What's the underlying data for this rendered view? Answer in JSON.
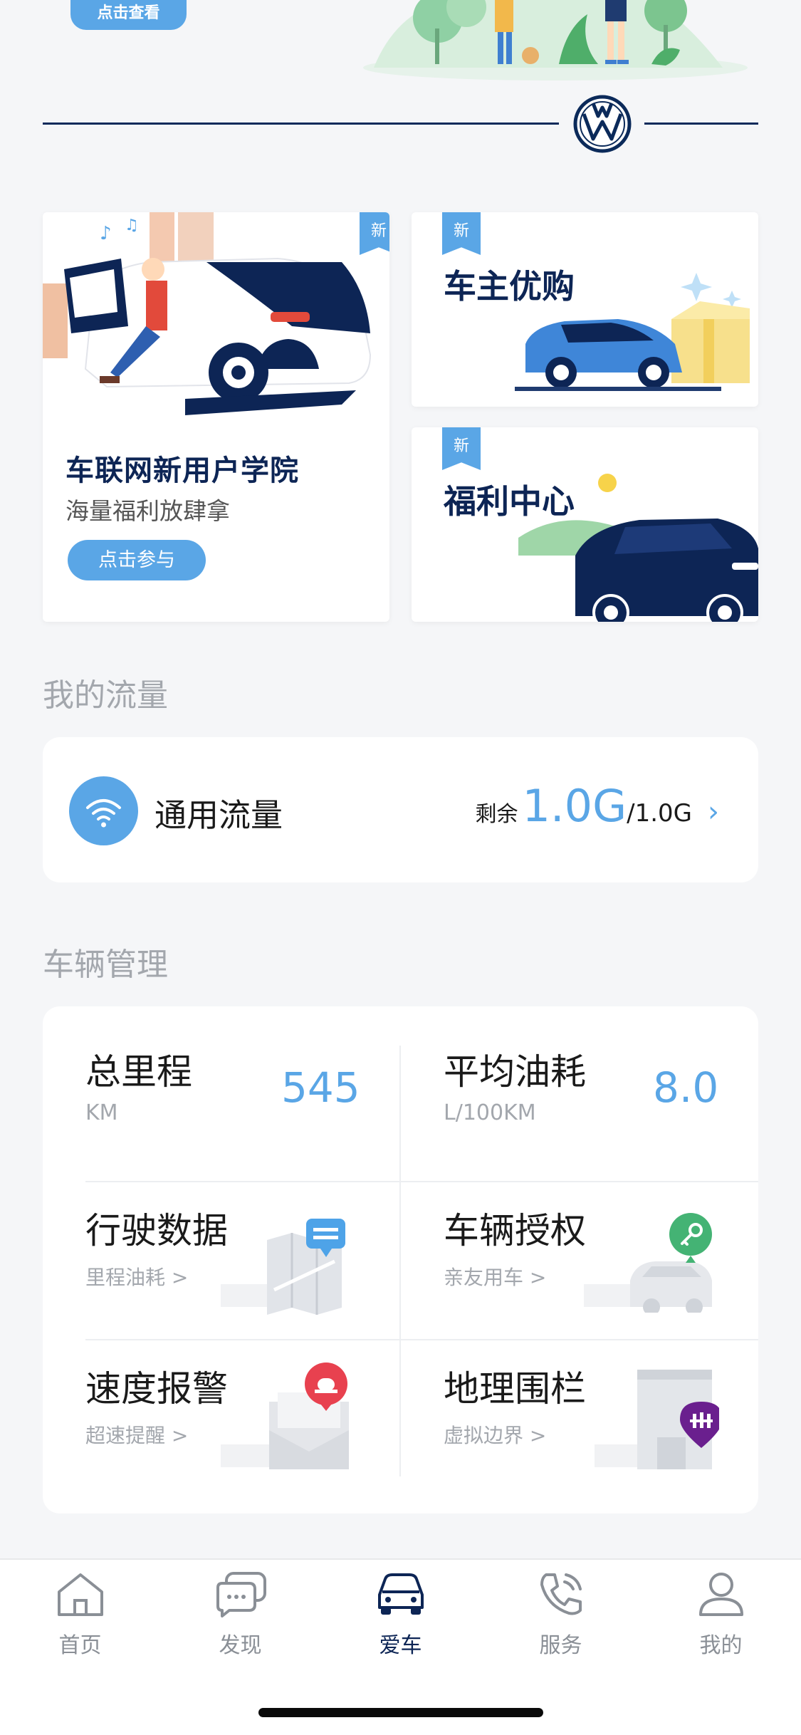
{
  "top_banner": {
    "cta_label": "点击查看"
  },
  "promo": {
    "academy": {
      "badge": "新",
      "title": "车联网新用户学院",
      "subtitle": "海量福利放肆拿",
      "button": "点击参与"
    },
    "shop": {
      "badge": "新",
      "title": "车主优购"
    },
    "welfare": {
      "badge": "新",
      "title": "福利中心"
    }
  },
  "data_section": {
    "title": "我的流量",
    "card": {
      "label": "通用流量",
      "remaining_label": "剩余",
      "remaining": "1.0G",
      "total": "/1.0G",
      "chevron": "›"
    }
  },
  "vehicle_section": {
    "title": "车辆管理",
    "mileage": {
      "title": "总里程",
      "unit": "KM",
      "value": "545"
    },
    "fuel": {
      "title": "平均油耗",
      "unit": "L/100KM",
      "value": "8.0"
    },
    "driving": {
      "title": "行驶数据",
      "sub": "里程油耗 >",
      "icon": "map-message-icon"
    },
    "authorize": {
      "title": "车辆授权",
      "sub": "亲友用车 >",
      "icon": "car-key-icon"
    },
    "speed": {
      "title": "速度报警",
      "sub": "超速提醒 >",
      "icon": "envelope-alarm-icon"
    },
    "geofence": {
      "title": "地理围栏",
      "sub": "虚拟边界 >",
      "icon": "fence-pin-icon"
    }
  },
  "tabbar": {
    "active": "爱车",
    "tabs": [
      {
        "label": "首页",
        "icon": "home-icon"
      },
      {
        "label": "发现",
        "icon": "chat-icon"
      },
      {
        "label": "爱车",
        "icon": "car-icon"
      },
      {
        "label": "服务",
        "icon": "phone-icon"
      },
      {
        "label": "我的",
        "icon": "user-icon"
      }
    ]
  },
  "colors": {
    "accent": "#5aa6e6",
    "navy": "#0d2555",
    "muted": "#a3a7ad",
    "background": "#f5f6f8"
  }
}
